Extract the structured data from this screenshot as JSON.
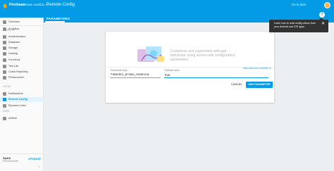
{
  "header": {
    "brand": "Firebase",
    "project": "Firebase sandbox",
    "project_caret": "▾",
    "page_title": "Remote Config",
    "go_to_docs": "Go to docs",
    "help_symbol": "?",
    "accent_color": "#039be5"
  },
  "tabs": [
    {
      "label": "PARAMETERS",
      "selected": true
    }
  ],
  "sidebar": {
    "items": [
      {
        "label": "Overview",
        "icon": "home-icon"
      },
      {
        "label": "Analytics",
        "icon": "analytics-icon"
      },
      {
        "label": "Authentication",
        "icon": "people-icon"
      },
      {
        "label": "Database",
        "icon": "database-icon"
      },
      {
        "label": "Storage",
        "icon": "storage-icon"
      },
      {
        "label": "Hosting",
        "icon": "globe-icon"
      },
      {
        "label": "Functions",
        "icon": "functions-icon"
      },
      {
        "label": "Test Lab",
        "icon": "flask-icon"
      },
      {
        "label": "Crash Reporting",
        "icon": "bug-icon"
      },
      {
        "label": "Performance",
        "icon": "speedometer-icon"
      },
      {
        "label": "Notifications",
        "icon": "chat-icon"
      },
      {
        "label": "Remote Config",
        "icon": "settings-tune-icon",
        "active": true
      },
      {
        "label": "Dynamic Links",
        "icon": "link-icon"
      },
      {
        "label": "AdMob",
        "icon": "admob-icon"
      }
    ],
    "sections": [
      "DEVELOP",
      "GROW",
      "EARN"
    ],
    "plan": "Spark",
    "plan_sub": "Free $0/month",
    "upgrade": "UPGRADE",
    "collapse": "‹"
  },
  "main": {
    "hero_text": "Customize and experiment with app behaviour using server-side configuration parameters",
    "param_key_label": "Parameter key",
    "param_key_value": "famedon_promo_enabled",
    "default_value_label": "Default value",
    "default_value_value": "true",
    "add_condition": "Add value for condition",
    "add_condition_caret": "▾",
    "cancel": "CANCEL",
    "add_parameter": "ADD PARAMETER"
  },
  "tooltip": {
    "text": "Learn how to read config values from your Android and iOS apps",
    "close": "✕"
  }
}
